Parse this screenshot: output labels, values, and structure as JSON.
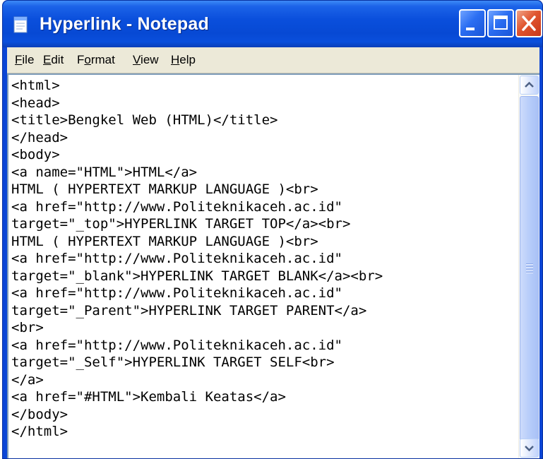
{
  "window": {
    "title": "Hyperlink - Notepad",
    "icons": {
      "app": "notepad-icon",
      "minimize": "minimize-icon",
      "maximize": "maximize-icon",
      "close": "close-icon"
    },
    "colors": {
      "titlebar": "#0a4fdc",
      "close": "#e0552f",
      "menubar": "#ece9d8"
    }
  },
  "menu": [
    {
      "first": "F",
      "rest": "ile"
    },
    {
      "first": "E",
      "rest": "dit"
    },
    {
      "pre": "F",
      "first": "o",
      "rest": "rmat"
    },
    {
      "first": "V",
      "rest": "iew"
    },
    {
      "first": "H",
      "rest": "elp"
    }
  ],
  "editor": {
    "lines": [
      "<html>",
      "<head>",
      "<title>Bengkel Web (HTML)</title>",
      "</head>",
      "<body>",
      "<a name=\"HTML\">HTML</a>",
      "HTML ( HYPERTEXT MARKUP LANGUAGE )<br>",
      "<a href=\"http://www.Politeknikaceh.ac.id\"",
      "target=\"_top\">HYPERLINK TARGET TOP</a><br>",
      "HTML ( HYPERTEXT MARKUP LANGUAGE )<br>",
      "<a href=\"http://www.Politeknikaceh.ac.id\"",
      "target=\"_blank\">HYPERLINK TARGET BLANK</a><br>",
      "<a href=\"http://www.Politeknikaceh.ac.id\"",
      "target=\"_Parent\">HYPERLINK TARGET PARENT</a>",
      "<br>",
      "<a href=\"http://www.Politeknikaceh.ac.id\"",
      "target=\"_Self\">HYPERLINK TARGET SELF<br>",
      "</a>",
      "<a href=\"#HTML\">Kembali Keatas</a>",
      "</body>",
      "</html>"
    ]
  },
  "scrollbar": {
    "up_icon": "scroll-up-arrow-icon",
    "down_icon": "scroll-down-arrow-icon",
    "position": 0
  }
}
